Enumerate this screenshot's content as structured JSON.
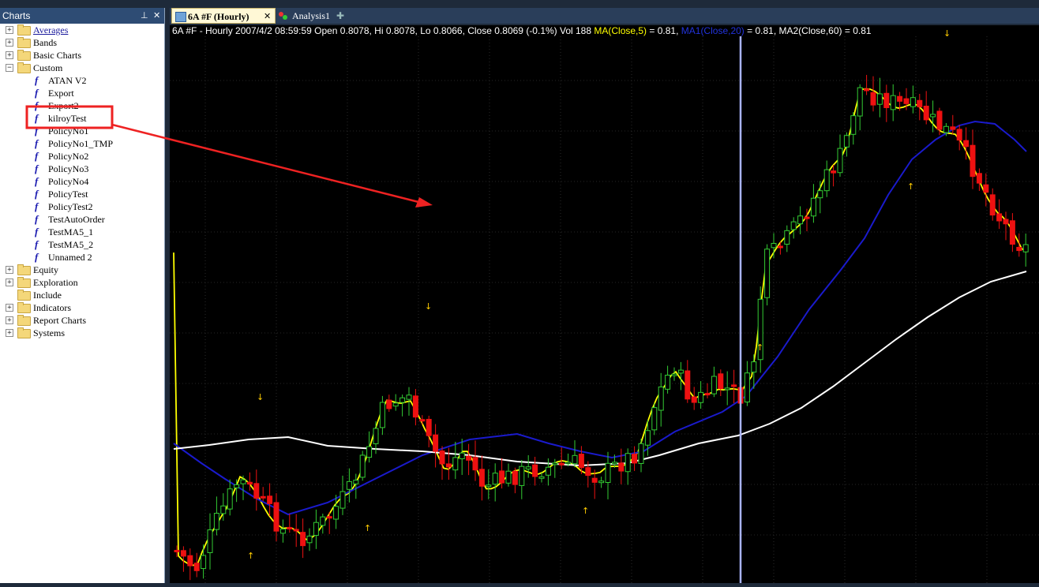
{
  "panel": {
    "title": "Charts",
    "pin_glyph": "⊥",
    "close_glyph": "✕"
  },
  "tree": [
    {
      "label": "Averages",
      "type": "folder",
      "underline": true
    },
    {
      "label": "Bands",
      "type": "folder"
    },
    {
      "label": "Basic Charts",
      "type": "folder"
    },
    {
      "label": "Custom",
      "type": "folder",
      "expanded": true,
      "children": [
        "ATAN V2",
        "Export",
        "Export2",
        "kilroyTest",
        "PolicyNo1",
        "PolicyNo1_TMP",
        "PolicyNo2",
        "PolicyNo3",
        "PolicyNo4",
        "PolicyTest",
        "PolicyTest2",
        "TestAutoOrder",
        "TestMA5_1",
        "TestMA5_2",
        "Unnamed 2"
      ]
    },
    {
      "label": "Equity",
      "type": "folder"
    },
    {
      "label": "Exploration",
      "type": "folder"
    },
    {
      "label": "Include",
      "type": "folder",
      "no_expander": true
    },
    {
      "label": "Indicators",
      "type": "folder"
    },
    {
      "label": "Report Charts",
      "type": "folder"
    },
    {
      "label": "Systems",
      "type": "folder"
    }
  ],
  "tabs": [
    {
      "label": "6A #F (Hourly)",
      "active": true,
      "close": "✕"
    },
    {
      "label": "Analysis1",
      "active": false
    },
    {
      "label": "✚",
      "active": false
    }
  ],
  "chart": {
    "info_prefix": "6A #F - Hourly 2007/4/2 08:59:59 Open 0.8078, Hi 0.8078, Lo 0.8066, Close 0.8069 (-0.1%) Vol 188 ",
    "ma1_label": "MA(Close,5)",
    "ma1_value": " = 0.81, ",
    "ma2_label": "MA1(Close,20)",
    "ma2_value": " = 0.81, MA2(Close,60) = 0.81",
    "colors": {
      "bg": "#000000",
      "up": "#33cc33",
      "down": "#ee1111",
      "ma5": "#ffff00",
      "ma20": "#1a1acc",
      "ma60": "#ffffff",
      "signal": "#ffcc00",
      "cursor": "#aab4ff",
      "highlight": "#ee2222"
    }
  }
}
